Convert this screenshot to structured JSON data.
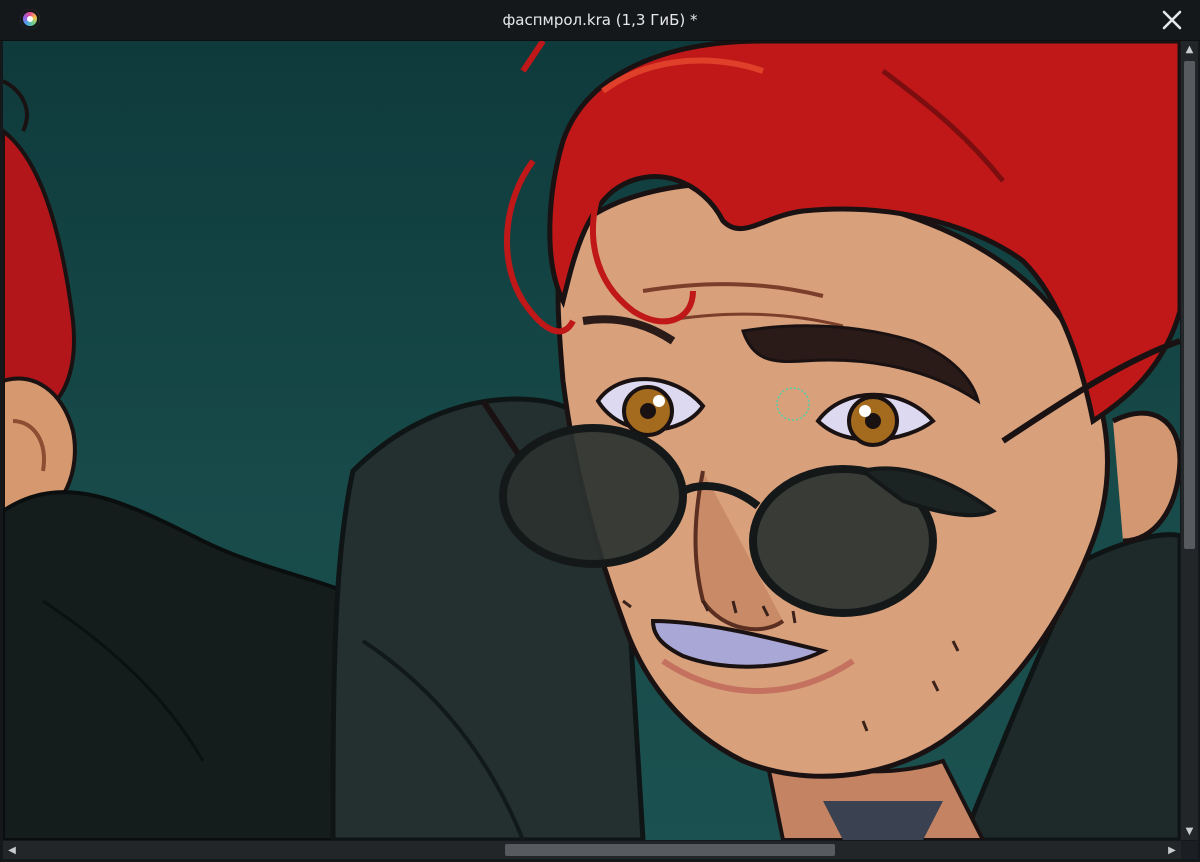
{
  "window": {
    "title": "фаспмрол.kra (1,3 ГиБ) *",
    "app_icon": "krita-app-icon",
    "close_icon": "close-icon"
  },
  "canvas": {
    "background_colors": [
      "#0f3a3c",
      "#1b5150"
    ],
    "content": "illustration"
  },
  "scrollbars": {
    "vertical": {
      "up_icon": "arrow-up-icon",
      "down_icon": "arrow-down-icon"
    },
    "horizontal": {
      "left_icon": "arrow-left-icon",
      "right_icon": "arrow-right-icon"
    }
  },
  "colors": {
    "titlebar": "#15181b",
    "title_text": "#e6e7e9",
    "scroll_track": "#232629",
    "scroll_thumb": "#575b60",
    "hair": "#c01818",
    "skin": "#d9a07c",
    "coat": "#1f2a29"
  }
}
